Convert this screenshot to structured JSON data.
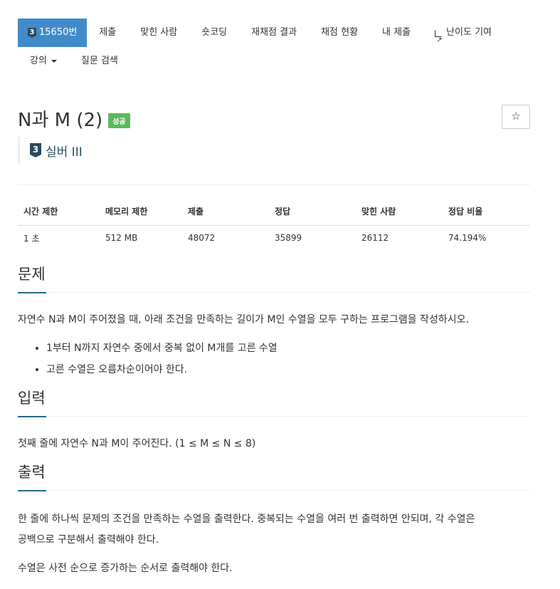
{
  "nav": {
    "items": [
      {
        "label": "15650번",
        "tier": "3",
        "active": true
      },
      {
        "label": "제출"
      },
      {
        "label": "맞힌 사람"
      },
      {
        "label": "숏코딩"
      },
      {
        "label": "재채점 결과"
      },
      {
        "label": "채점 현황"
      },
      {
        "label": "내 제출"
      },
      {
        "label": "난이도 기여",
        "icon": "external-link-icon"
      }
    ],
    "second": [
      {
        "label": "강의",
        "icon": "caret-down-icon"
      },
      {
        "label": "질문 검색"
      }
    ]
  },
  "problem": {
    "title": "N과 M (2)",
    "status_badge": "성공",
    "star": "☆",
    "tier_num": "3",
    "tier_label": "실버 III"
  },
  "info_table": {
    "headers": [
      "시간 제한",
      "메모리 제한",
      "제출",
      "정답",
      "맞힌 사람",
      "정답 비율"
    ],
    "values": [
      "1 초",
      "512 MB",
      "48072",
      "35899",
      "26112",
      "74.194%"
    ]
  },
  "sections": {
    "problem": {
      "title": "문제",
      "text": "자연수 N과 M이 주어졌을 때, 아래 조건을 만족하는 길이가 M인 수열을 모두 구하는 프로그램을 작성하시오.",
      "items": [
        "1부터 N까지 자연수 중에서 중복 없이 M개를 고른 수열",
        "고른 수열은 오름차순이어야 한다."
      ]
    },
    "input": {
      "title": "입력",
      "text": "첫째 줄에 자연수 N과 M이 주어진다. (1 ≤ M ≤ N ≤ 8)"
    },
    "output": {
      "title": "출력",
      "text1_line1": "한 줄에 하나씩 문제의 조건을 만족하는 수열을 출력한다. 중복되는 수열을 여러 번 출력하면 안되며, 각 수열은",
      "text1_line2": "공백으로 구분해서 출력해야 한다.",
      "text2": "수열은 사전 순으로 증가하는 순서로 출력해야 한다."
    }
  },
  "colors": {
    "active_tab": "#428bca",
    "success": "#5cb85c",
    "tier": "#2b4b5f",
    "accent": "#1e6b88"
  }
}
